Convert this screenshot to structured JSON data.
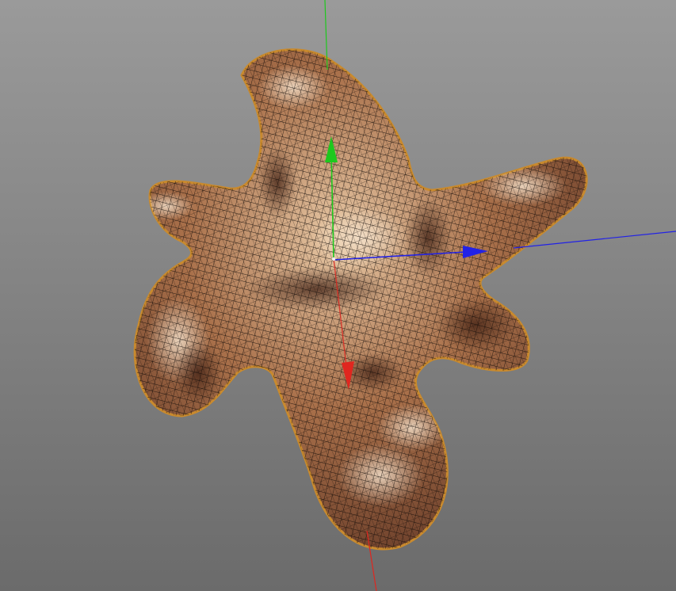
{
  "viewport": {
    "background": {
      "top": "#9a9a9a",
      "bottom": "#6b6b6b"
    },
    "mesh": {
      "name": "textured-blob",
      "display": "textured-wireframe",
      "base_color": "#a9704a",
      "highlight_color": "#e8c9a6",
      "shadow_color": "#5b3222",
      "wire_color": "#120c08",
      "outline_color": "#c98a2e"
    },
    "gizmo": {
      "type": "translate",
      "axes": [
        {
          "axis": "y",
          "color": "#1ec81e"
        },
        {
          "axis": "x",
          "color": "#e0261f"
        },
        {
          "axis": "z",
          "color": "#2222e6"
        }
      ]
    }
  }
}
